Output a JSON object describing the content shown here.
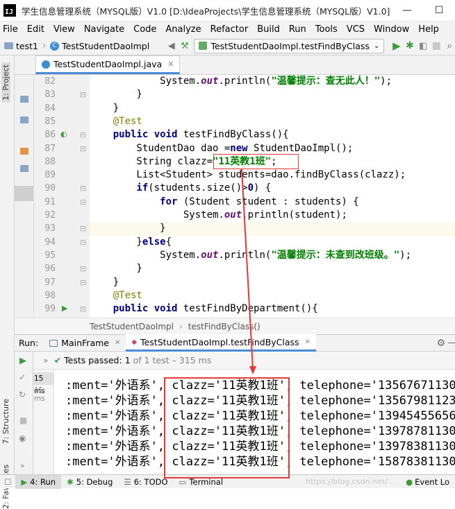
{
  "window": {
    "title": "学生信息管理系统（MYSQL版）V1.0 [D:\\IdeaProjects\\学生信息管理系统（MYSQL版）V1.0] - ...",
    "minimize": "—",
    "maximize": "☐"
  },
  "menu": [
    "File",
    "Edit",
    "View",
    "Navigate",
    "Code",
    "Analyze",
    "Refactor",
    "Build",
    "Run",
    "Tools",
    "VCS",
    "Window",
    "Help"
  ],
  "nav": {
    "project": "test1",
    "file": "TestStudentDaoImpl",
    "run_config": "TestStudentDaoImpl.testFindByClass"
  },
  "editor": {
    "tab": "TestStudentDaoImpl.java",
    "lines": [
      {
        "n": "82",
        "segs": [
          {
            "c": "",
            "t": "            System."
          },
          {
            "c": "fi",
            "t": "out"
          },
          {
            "c": "",
            "t": ".println("
          },
          {
            "c": "st",
            "t": "\"温馨提示：查无此人！\""
          },
          {
            "c": "",
            "t": ");"
          }
        ]
      },
      {
        "n": "83",
        "segs": [
          {
            "c": "",
            "t": "        }"
          }
        ]
      },
      {
        "n": "84",
        "segs": [
          {
            "c": "",
            "t": "    }"
          }
        ]
      },
      {
        "n": "85",
        "segs": [
          {
            "c": "an",
            "t": "    @Test"
          }
        ]
      },
      {
        "n": "86",
        "segs": [
          {
            "c": "kw",
            "t": "    public void "
          },
          {
            "c": "",
            "t": "testFindByClass(){"
          }
        ]
      },
      {
        "n": "87",
        "segs": [
          {
            "c": "",
            "t": "        StudentDao dao ="
          },
          {
            "c": "kw",
            "t": "new "
          },
          {
            "c": "",
            "t": "StudentDaoImpl();"
          }
        ]
      },
      {
        "n": "88",
        "segs": [
          {
            "c": "",
            "t": "        String clazz="
          },
          {
            "c": "st",
            "t": "\"11英教1班\""
          },
          {
            "c": "",
            "t": ";"
          }
        ]
      },
      {
        "n": "89",
        "segs": [
          {
            "c": "",
            "t": "        List<Student> students=dao.findByClass(clazz);"
          }
        ]
      },
      {
        "n": "90",
        "segs": [
          {
            "c": "kw",
            "t": "        if"
          },
          {
            "c": "",
            "t": "(students.size()>"
          },
          {
            "c": "kw",
            "t": "0"
          },
          {
            "c": "",
            "t": ") {"
          }
        ]
      },
      {
        "n": "91",
        "segs": [
          {
            "c": "kw",
            "t": "            for "
          },
          {
            "c": "",
            "t": "(Student student : students) {"
          }
        ]
      },
      {
        "n": "92",
        "segs": [
          {
            "c": "",
            "t": "                System."
          },
          {
            "c": "fi",
            "t": "out"
          },
          {
            "c": "",
            "t": ".println(student);"
          }
        ]
      },
      {
        "n": "93",
        "segs": [
          {
            "c": "",
            "t": "            }"
          }
        ]
      },
      {
        "n": "94",
        "segs": [
          {
            "c": "",
            "t": "        }"
          },
          {
            "c": "kw",
            "t": "else"
          },
          {
            "c": "",
            "t": "{"
          }
        ]
      },
      {
        "n": "95",
        "segs": [
          {
            "c": "",
            "t": "            System."
          },
          {
            "c": "fi",
            "t": "out"
          },
          {
            "c": "",
            "t": ".println("
          },
          {
            "c": "st",
            "t": "\"温馨提示：未查到改班级。\""
          },
          {
            "c": "",
            "t": ");"
          }
        ]
      },
      {
        "n": "96",
        "segs": [
          {
            "c": "",
            "t": "        }"
          }
        ]
      },
      {
        "n": "97",
        "segs": [
          {
            "c": "",
            "t": "    }"
          }
        ]
      },
      {
        "n": "98",
        "segs": [
          {
            "c": "an",
            "t": "    @Test"
          }
        ]
      },
      {
        "n": "99",
        "segs": [
          {
            "c": "kw",
            "t": "    public void "
          },
          {
            "c": "",
            "t": "testFindByDepartment(){"
          }
        ]
      }
    ],
    "breadcrumb": [
      "TestStudentDaoImpl",
      "testFindByClass()"
    ]
  },
  "run": {
    "label": "Run:",
    "tabs": [
      "MainFrame",
      "TestStudentDaoImpl.testFindByClass"
    ],
    "status": "Tests passed:",
    "passed": "1",
    "of": "of 1 test – 315 ms",
    "times": [
      "15 ms",
      "15 ms"
    ],
    "output": [
      ":ment='外语系', clazz='11英教1班', telephone='13567671130",
      ":ment='外语系', clazz='11英教1班', telephone='13567981123",
      ":ment='外语系', clazz='11英教1班', telephone='13945455656",
      ":ment='外语系', clazz='11英教1班', telephone='13978781130",
      ":ment='外语系', clazz='11英教1班', telephone='13978381130",
      ":ment='外语系', clazz='11英教1班', telephone='15878381130"
    ]
  },
  "side_tabs": {
    "project": "1: Project",
    "structure": "7: Structure",
    "favorites": "2: Favorites"
  },
  "bottom": {
    "run": "4: Run",
    "debug": "5: Debug",
    "todo": "6: TODO",
    "terminal": "Terminal",
    "event": "Event Lo",
    "watermark": "https://blog.csdn.net/..."
  }
}
